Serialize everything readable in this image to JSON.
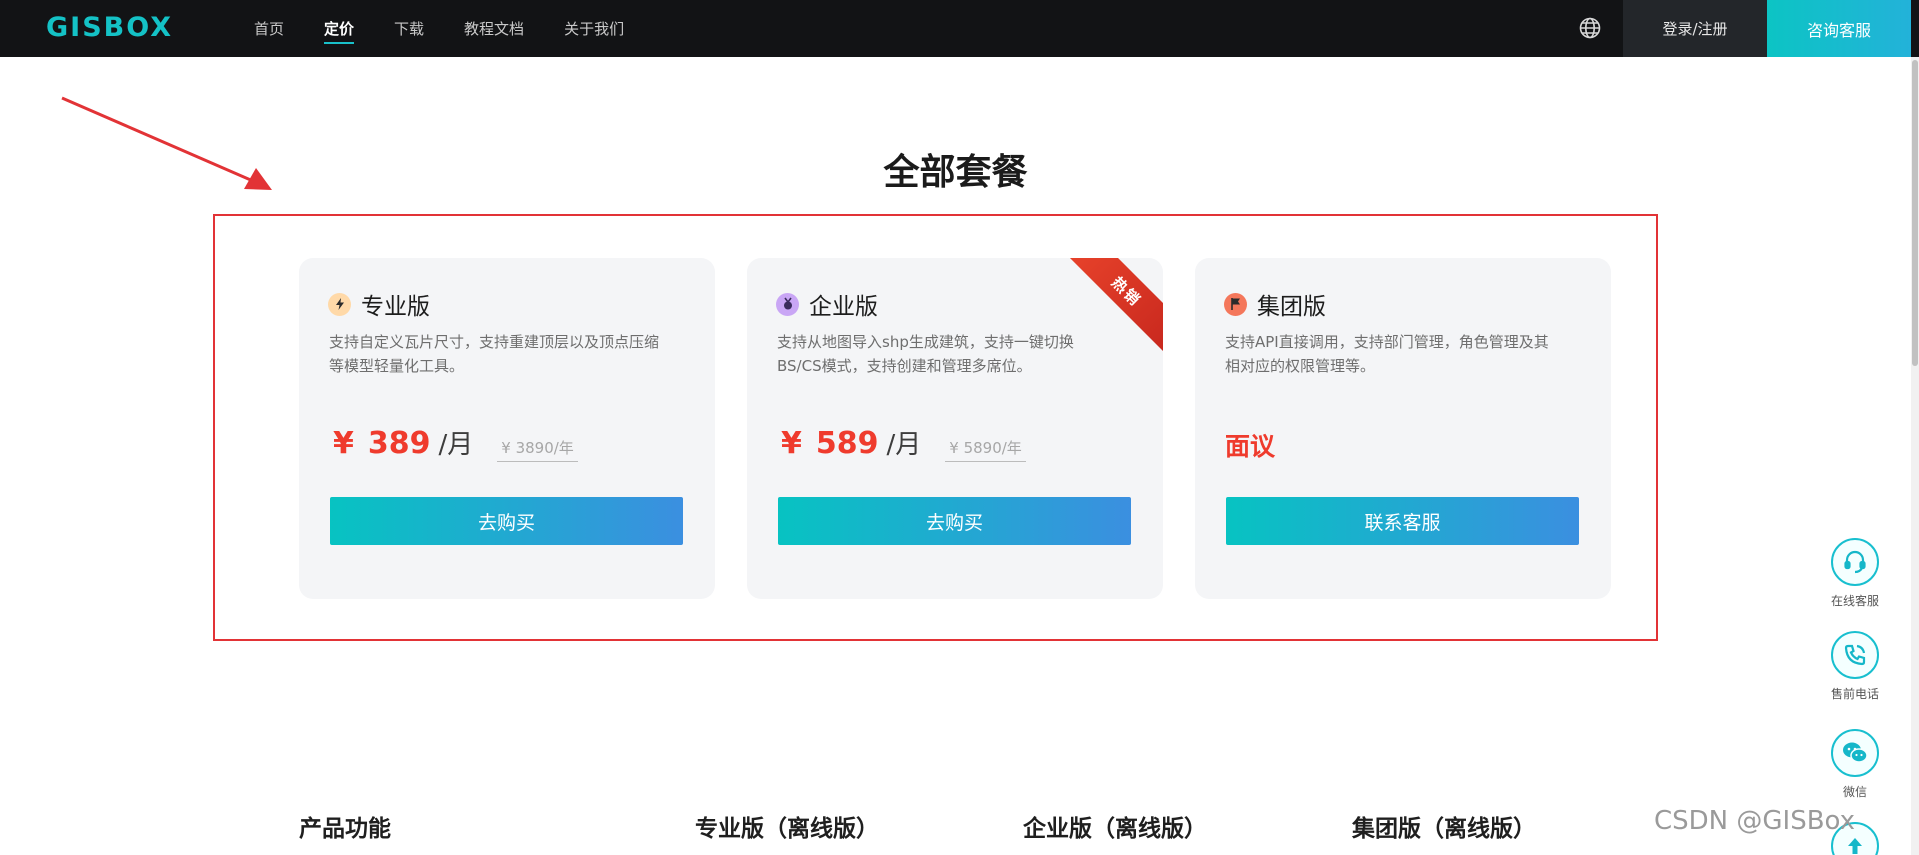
{
  "nav": {
    "logo": "GISBOX",
    "links": [
      {
        "label": "首页",
        "active": false
      },
      {
        "label": "定价",
        "active": true
      },
      {
        "label": "下载",
        "active": false
      },
      {
        "label": "教程文档",
        "active": false
      },
      {
        "label": "关于我们",
        "active": false
      }
    ],
    "login_label": "登录/注册",
    "consult_label": "咨询客服"
  },
  "section_title": "全部套餐",
  "plans": [
    {
      "icon": "lightning-icon",
      "name": "专业版",
      "desc_line1": "支持自定义瓦片尺寸，支持重建顶层以及顶点压缩",
      "desc_line2": "等模型轻量化工具。",
      "price_symbol": "¥",
      "price_value": "389",
      "price_unit": "/月",
      "price_old": "¥ 3890/年",
      "button_label": "去购买"
    },
    {
      "icon": "medal-icon",
      "name": "企业版",
      "desc_line1": "支持从地图导入shp生成建筑，支持一键切换",
      "desc_line2": "BS/CS模式，支持创建和管理多席位。",
      "price_symbol": "¥",
      "price_value": "589",
      "price_unit": "/月",
      "price_old": "¥ 5890/年",
      "ribbon": "热销",
      "button_label": "去购买"
    },
    {
      "icon": "flag-icon",
      "name": "集团版",
      "desc_line1": "支持API直接调用，支持部门管理，角色管理及其",
      "desc_line2": "相对应的权限管理等。",
      "price_text": "面议",
      "button_label": "联系客服"
    }
  ],
  "side_widgets": [
    {
      "icon": "headset-icon",
      "label": "在线客服"
    },
    {
      "icon": "phone-icon",
      "label": "售前电话"
    },
    {
      "icon": "wechat-icon",
      "label": "微信"
    },
    {
      "icon": "arrow-up-icon",
      "label": ""
    }
  ],
  "compare_headers": [
    "产品功能",
    "专业版（离线版）",
    "企业版（离线版）",
    "集团版（离线版）"
  ],
  "watermark": "CSDN @GISBox",
  "colors": {
    "accent": "#14c2c6",
    "price_red": "#ef3b2d",
    "annotation_red": "#e23336",
    "nav_bg": "#121315"
  }
}
